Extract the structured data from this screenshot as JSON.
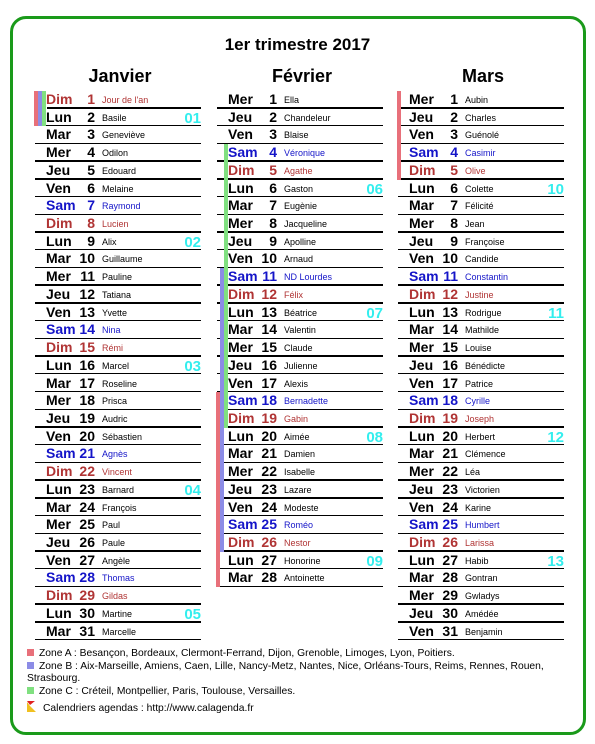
{
  "title": "1er trimestre 2017",
  "colors": {
    "border": "#1a9a1a",
    "zoneA": "#e8707a",
    "zoneB": "#8c8ce6",
    "zoneC": "#80e080",
    "saturday": "#1414c8",
    "sunday": "#b03434",
    "week": "#33eeee"
  },
  "months": [
    {
      "name": "Janvier",
      "days": [
        {
          "d": "Dim",
          "n": "1",
          "s": "Jour de l'an",
          "t": "dim"
        },
        {
          "d": "Lun",
          "n": "2",
          "s": "Basile",
          "t": "wk",
          "w": "01"
        },
        {
          "d": "Mar",
          "n": "3",
          "s": "Geneviève",
          "t": "wk"
        },
        {
          "d": "Mer",
          "n": "4",
          "s": "Odilon",
          "t": "wk"
        },
        {
          "d": "Jeu",
          "n": "5",
          "s": "Edouard",
          "t": "wk"
        },
        {
          "d": "Ven",
          "n": "6",
          "s": "Melaine",
          "t": "wk"
        },
        {
          "d": "Sam",
          "n": "7",
          "s": "Raymond",
          "t": "sam"
        },
        {
          "d": "Dim",
          "n": "8",
          "s": "Lucien",
          "t": "dim"
        },
        {
          "d": "Lun",
          "n": "9",
          "s": "Alix",
          "t": "wk",
          "w": "02"
        },
        {
          "d": "Mar",
          "n": "10",
          "s": "Guillaume",
          "t": "wk"
        },
        {
          "d": "Mer",
          "n": "11",
          "s": "Pauline",
          "t": "wk"
        },
        {
          "d": "Jeu",
          "n": "12",
          "s": "Tatiana",
          "t": "wk"
        },
        {
          "d": "Ven",
          "n": "13",
          "s": "Yvette",
          "t": "wk"
        },
        {
          "d": "Sam",
          "n": "14",
          "s": "Nina",
          "t": "sam"
        },
        {
          "d": "Dim",
          "n": "15",
          "s": "Rémi",
          "t": "dim"
        },
        {
          "d": "Lun",
          "n": "16",
          "s": "Marcel",
          "t": "wk",
          "w": "03"
        },
        {
          "d": "Mar",
          "n": "17",
          "s": "Roseline",
          "t": "wk"
        },
        {
          "d": "Mer",
          "n": "18",
          "s": "Prisca",
          "t": "wk"
        },
        {
          "d": "Jeu",
          "n": "19",
          "s": "Audric",
          "t": "wk"
        },
        {
          "d": "Ven",
          "n": "20",
          "s": "Sébastien",
          "t": "wk"
        },
        {
          "d": "Sam",
          "n": "21",
          "s": "Agnès",
          "t": "sam"
        },
        {
          "d": "Dim",
          "n": "22",
          "s": "Vincent",
          "t": "dim"
        },
        {
          "d": "Lun",
          "n": "23",
          "s": "Barnard",
          "t": "wk",
          "w": "04"
        },
        {
          "d": "Mar",
          "n": "24",
          "s": "François",
          "t": "wk"
        },
        {
          "d": "Mer",
          "n": "25",
          "s": "Paul",
          "t": "wk"
        },
        {
          "d": "Jeu",
          "n": "26",
          "s": "Paule",
          "t": "wk"
        },
        {
          "d": "Ven",
          "n": "27",
          "s": "Angèle",
          "t": "wk"
        },
        {
          "d": "Sam",
          "n": "28",
          "s": "Thomas",
          "t": "sam"
        },
        {
          "d": "Dim",
          "n": "29",
          "s": "Gildas",
          "t": "dim"
        },
        {
          "d": "Lun",
          "n": "30",
          "s": "Martine",
          "t": "wk",
          "w": "05"
        },
        {
          "d": "Mar",
          "n": "31",
          "s": "Marcelle",
          "t": "wk"
        }
      ],
      "zones": [
        {
          "zone": "A",
          "from": 1,
          "to": 2
        },
        {
          "zone": "B",
          "from": 1,
          "to": 2
        },
        {
          "zone": "C",
          "from": 1,
          "to": 2
        }
      ]
    },
    {
      "name": "Février",
      "days": [
        {
          "d": "Mer",
          "n": "1",
          "s": "Ella",
          "t": "wk"
        },
        {
          "d": "Jeu",
          "n": "2",
          "s": "Chandeleur",
          "t": "wk"
        },
        {
          "d": "Ven",
          "n": "3",
          "s": "Blaise",
          "t": "wk"
        },
        {
          "d": "Sam",
          "n": "4",
          "s": "Véronique",
          "t": "sam"
        },
        {
          "d": "Dim",
          "n": "5",
          "s": "Agathe",
          "t": "dim"
        },
        {
          "d": "Lun",
          "n": "6",
          "s": "Gaston",
          "t": "wk",
          "w": "06"
        },
        {
          "d": "Mar",
          "n": "7",
          "s": "Eugènie",
          "t": "wk"
        },
        {
          "d": "Mer",
          "n": "8",
          "s": "Jacqueline",
          "t": "wk"
        },
        {
          "d": "Jeu",
          "n": "9",
          "s": "Apolline",
          "t": "wk"
        },
        {
          "d": "Ven",
          "n": "10",
          "s": "Arnaud",
          "t": "wk"
        },
        {
          "d": "Sam",
          "n": "11",
          "s": "ND Lourdes",
          "t": "sam"
        },
        {
          "d": "Dim",
          "n": "12",
          "s": "Félix",
          "t": "dim"
        },
        {
          "d": "Lun",
          "n": "13",
          "s": "Béatrice",
          "t": "wk",
          "w": "07"
        },
        {
          "d": "Mar",
          "n": "14",
          "s": "Valentin",
          "t": "wk"
        },
        {
          "d": "Mer",
          "n": "15",
          "s": "Claude",
          "t": "wk"
        },
        {
          "d": "Jeu",
          "n": "16",
          "s": "Julienne",
          "t": "wk"
        },
        {
          "d": "Ven",
          "n": "17",
          "s": "Alexis",
          "t": "wk"
        },
        {
          "d": "Sam",
          "n": "18",
          "s": "Bernadette",
          "t": "sam"
        },
        {
          "d": "Dim",
          "n": "19",
          "s": "Gabin",
          "t": "dim"
        },
        {
          "d": "Lun",
          "n": "20",
          "s": "Aimée",
          "t": "wk",
          "w": "08"
        },
        {
          "d": "Mar",
          "n": "21",
          "s": "Damien",
          "t": "wk"
        },
        {
          "d": "Mer",
          "n": "22",
          "s": "Isabelle",
          "t": "wk"
        },
        {
          "d": "Jeu",
          "n": "23",
          "s": "Lazare",
          "t": "wk"
        },
        {
          "d": "Ven",
          "n": "24",
          "s": "Modeste",
          "t": "wk"
        },
        {
          "d": "Sam",
          "n": "25",
          "s": "Roméo",
          "t": "sam"
        },
        {
          "d": "Dim",
          "n": "26",
          "s": "Nestor",
          "t": "dim"
        },
        {
          "d": "Lun",
          "n": "27",
          "s": "Honorine",
          "t": "wk",
          "w": "09"
        },
        {
          "d": "Mar",
          "n": "28",
          "s": "Antoinette",
          "t": "wk"
        }
      ],
      "zones": [
        {
          "zone": "A",
          "from": 18,
          "to": 28
        },
        {
          "zone": "B",
          "from": 11,
          "to": 26
        },
        {
          "zone": "C",
          "from": 4,
          "to": 19
        }
      ]
    },
    {
      "name": "Mars",
      "days": [
        {
          "d": "Mer",
          "n": "1",
          "s": "Aubin",
          "t": "wk"
        },
        {
          "d": "Jeu",
          "n": "2",
          "s": "Charles",
          "t": "wk"
        },
        {
          "d": "Ven",
          "n": "3",
          "s": "Guénolé",
          "t": "wk"
        },
        {
          "d": "Sam",
          "n": "4",
          "s": "Casimir",
          "t": "sam"
        },
        {
          "d": "Dim",
          "n": "5",
          "s": "Olive",
          "t": "dim"
        },
        {
          "d": "Lun",
          "n": "6",
          "s": "Colette",
          "t": "wk",
          "w": "10"
        },
        {
          "d": "Mar",
          "n": "7",
          "s": "Félicité",
          "t": "wk"
        },
        {
          "d": "Mer",
          "n": "8",
          "s": "Jean",
          "t": "wk"
        },
        {
          "d": "Jeu",
          "n": "9",
          "s": "Françoise",
          "t": "wk"
        },
        {
          "d": "Ven",
          "n": "10",
          "s": "Candide",
          "t": "wk"
        },
        {
          "d": "Sam",
          "n": "11",
          "s": "Constantin",
          "t": "sam"
        },
        {
          "d": "Dim",
          "n": "12",
          "s": "Justine",
          "t": "dim"
        },
        {
          "d": "Lun",
          "n": "13",
          "s": "Rodrigue",
          "t": "wk",
          "w": "11"
        },
        {
          "d": "Mar",
          "n": "14",
          "s": "Mathilde",
          "t": "wk"
        },
        {
          "d": "Mer",
          "n": "15",
          "s": "Louise",
          "t": "wk"
        },
        {
          "d": "Jeu",
          "n": "16",
          "s": "Bénédicte",
          "t": "wk"
        },
        {
          "d": "Ven",
          "n": "17",
          "s": "Patrice",
          "t": "wk"
        },
        {
          "d": "Sam",
          "n": "18",
          "s": "Cyrille",
          "t": "sam"
        },
        {
          "d": "Dim",
          "n": "19",
          "s": "Joseph",
          "t": "dim"
        },
        {
          "d": "Lun",
          "n": "20",
          "s": "Herbert",
          "t": "wk",
          "w": "12"
        },
        {
          "d": "Mar",
          "n": "21",
          "s": "Clémence",
          "t": "wk"
        },
        {
          "d": "Mer",
          "n": "22",
          "s": "Léa",
          "t": "wk"
        },
        {
          "d": "Jeu",
          "n": "23",
          "s": "Victorien",
          "t": "wk"
        },
        {
          "d": "Ven",
          "n": "24",
          "s": "Karine",
          "t": "wk"
        },
        {
          "d": "Sam",
          "n": "25",
          "s": "Humbert",
          "t": "sam"
        },
        {
          "d": "Dim",
          "n": "26",
          "s": "Larissa",
          "t": "dim"
        },
        {
          "d": "Lun",
          "n": "27",
          "s": "Habib",
          "t": "wk",
          "w": "13"
        },
        {
          "d": "Mar",
          "n": "28",
          "s": "Gontran",
          "t": "wk"
        },
        {
          "d": "Mer",
          "n": "29",
          "s": "Gwladys",
          "t": "wk"
        },
        {
          "d": "Jeu",
          "n": "30",
          "s": "Amédée",
          "t": "wk"
        },
        {
          "d": "Ven",
          "n": "31",
          "s": "Benjamin",
          "t": "wk"
        }
      ],
      "zones": [
        {
          "zone": "A",
          "from": 1,
          "to": 5
        }
      ]
    }
  ],
  "legend": {
    "zoneA": "Zone A : Besançon, Bordeaux, Clermont-Ferrand, Dijon, Grenoble, Limoges, Lyon, Poitiers.",
    "zoneB": "Zone B : Aix-Marseille, Amiens, Caen, Lille, Nancy-Metz, Nantes, Nice, Orléans-Tours, Reims, Rennes, Rouen, Strasbourg.",
    "zoneC": "Zone C : Créteil, Montpellier, Paris, Toulouse, Versailles.",
    "credit": "Calendriers agendas : http://www.calagenda.fr"
  }
}
